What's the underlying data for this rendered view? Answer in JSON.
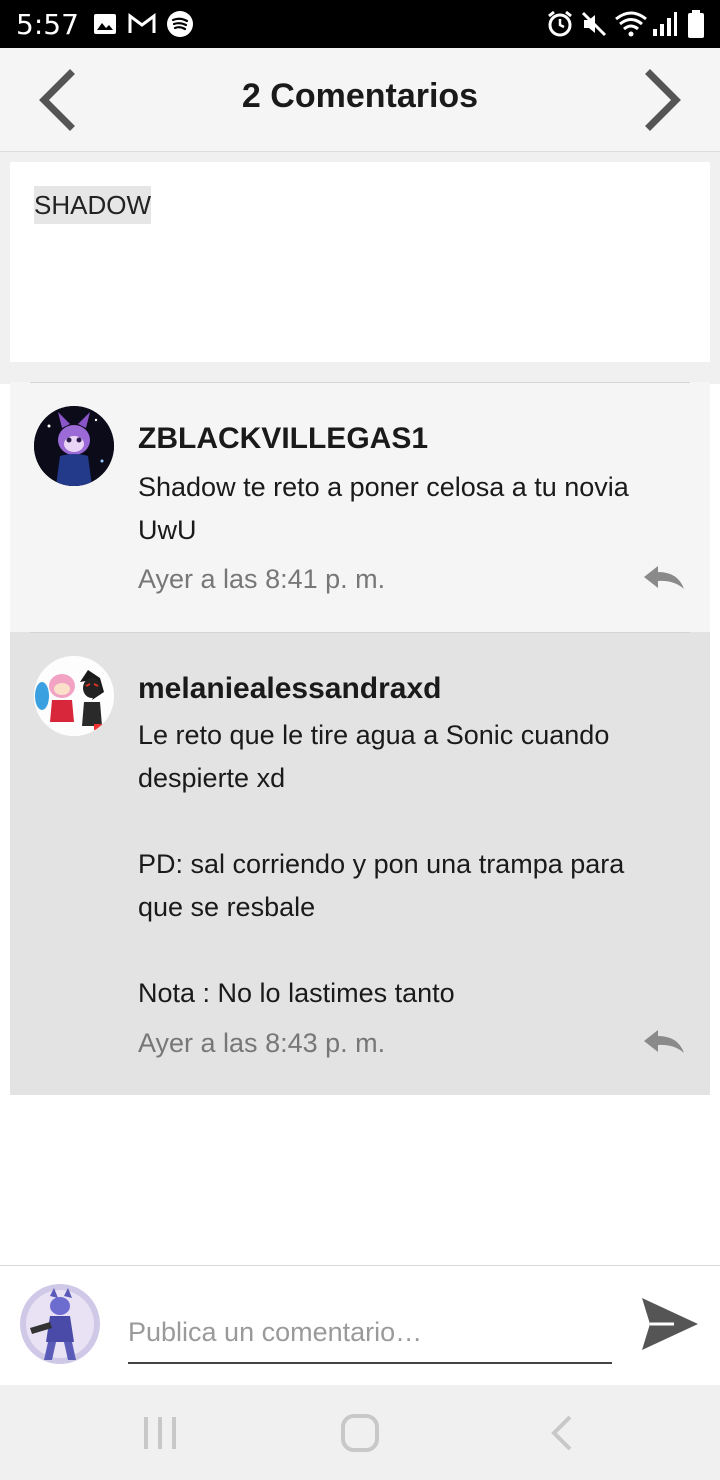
{
  "status_bar": {
    "time": "5:57",
    "left_icons": [
      "image-icon",
      "gmail-icon",
      "spotify-icon"
    ],
    "right_icons": [
      "alarm-icon",
      "mute-icon",
      "wifi-icon",
      "signal-icon",
      "battery-icon"
    ]
  },
  "header": {
    "title": "2 Comentarios",
    "prev_icon": "chevron-left-icon",
    "next_icon": "chevron-right-icon"
  },
  "post": {
    "title": "SHADOW"
  },
  "comments": [
    {
      "username": "ZBLACKVILLEGAS1",
      "text": "Shadow te reto a poner celosa a tu novia\nUwU",
      "time": "Ayer a las 8:41 p. m."
    },
    {
      "username": "melaniealessandraxd",
      "text": "Le reto que le tire agua a Sonic cuando\ndespierte xd\n\nPD: sal corriendo y pon una trampa para\nque se resbale\n\nNota : No lo lastimes tanto",
      "time": "Ayer a las 8:43 p. m."
    }
  ],
  "composer": {
    "placeholder": "Publica un comentario…"
  },
  "colors": {
    "status_bar": "#000000",
    "header_bg": "#f5f5f5",
    "comment_1_bg": "#f5f5f5",
    "comment_2_bg": "#e3e3e3",
    "muted_text": "#777777"
  }
}
